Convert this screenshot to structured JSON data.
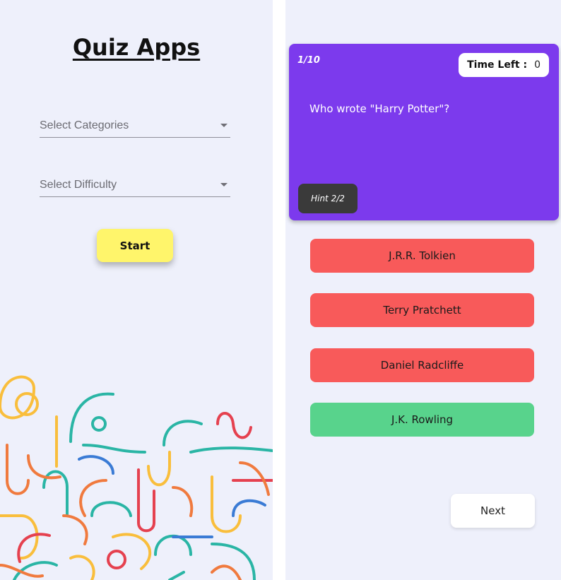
{
  "home": {
    "title": "Quiz Apps",
    "category_select": {
      "placeholder": "Select Categories",
      "icon": "caret-down-icon"
    },
    "difficulty_select": {
      "placeholder": "Select Difficulty",
      "icon": "caret-down-icon"
    },
    "start_label": "Start",
    "colors": {
      "background": "#eef0fb",
      "start_button": "#fff56b"
    },
    "decoration": "colorful-line-doodle"
  },
  "quiz": {
    "progress": "1/10",
    "timer": {
      "label": "Time Left :",
      "value": "0"
    },
    "question": "Who wrote \"Harry Potter\"?",
    "hint_label": "Hint 2/2",
    "answers": [
      {
        "label": "J.R.R. Tolkien",
        "state": "wrong"
      },
      {
        "label": "Terry Pratchett",
        "state": "wrong"
      },
      {
        "label": "Daniel Radcliffe",
        "state": "wrong"
      },
      {
        "label": "J.K. Rowling",
        "state": "correct"
      }
    ],
    "next_label": "Next",
    "colors": {
      "card": "#7c3aed",
      "wrong": "#f85a5a",
      "correct": "#58d38c",
      "hint_button": "#3a3a3a"
    }
  }
}
